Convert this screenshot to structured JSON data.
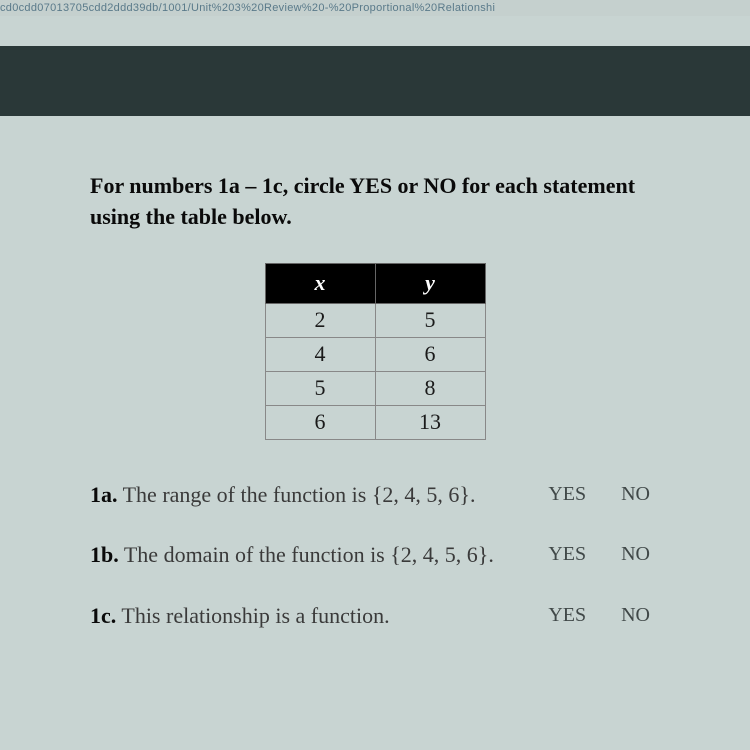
{
  "urlFragment": "cd0cdd07013705cdd2ddd39db/1001/Unit%203%20Review%20-%20Proportional%20Relationshi",
  "instructions": "For numbers 1a – 1c, circle YES or NO for each statement using the table below.",
  "table": {
    "headers": {
      "col1": "x",
      "col2": "y"
    },
    "rows": [
      {
        "x": "2",
        "y": "5"
      },
      {
        "x": "4",
        "y": "6"
      },
      {
        "x": "5",
        "y": "8"
      },
      {
        "x": "6",
        "y": "13"
      }
    ]
  },
  "questions": {
    "q1a": {
      "label": "1a.",
      "text": "The range of the function is {2, 4, 5, 6}."
    },
    "q1b": {
      "label": "1b.",
      "text": "The domain of the function is {2, 4, 5, 6}."
    },
    "q1c": {
      "label": "1c.",
      "text": "This relationship is a function."
    }
  },
  "options": {
    "yes": "YES",
    "no": "NO"
  }
}
